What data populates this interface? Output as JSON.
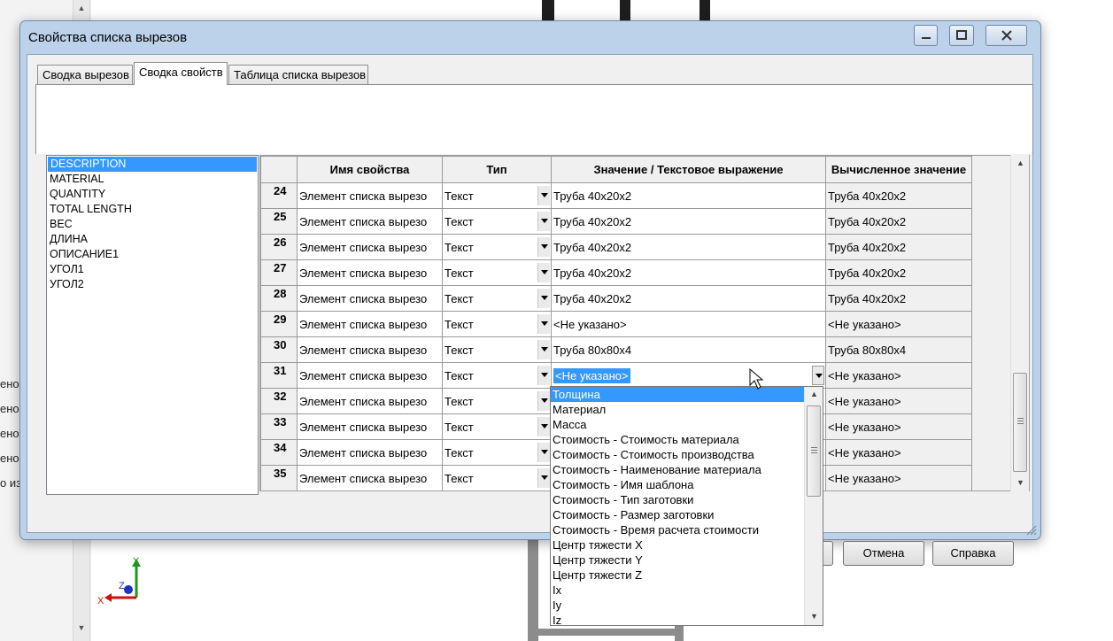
{
  "background": {
    "partial_lines": [
      "ено",
      "ено",
      "ено",
      "ено",
      "о из"
    ],
    "triad_labels": {
      "y": "Y",
      "z": "Z",
      "x": "X"
    }
  },
  "dialog": {
    "title": "Свойства списка вырезов",
    "tabs": [
      {
        "label": "Сводка вырезов"
      },
      {
        "label": "Сводка свойств"
      },
      {
        "label": "Таблица списка вырезов"
      }
    ],
    "active_tab": 1,
    "property_list": [
      "DESCRIPTION",
      "MATERIAL",
      "QUANTITY",
      "TOTAL LENGTH",
      "ВЕС",
      "ДЛИНА",
      "ОПИСАНИЕ1",
      "УГОЛ1",
      "УГОЛ2"
    ],
    "selected_property": 0,
    "grid": {
      "headers": [
        "",
        "Имя свойства",
        "Тип",
        "Значение / Текстовое выражение",
        "Вычисленное значение"
      ],
      "rows": [
        {
          "num": "24",
          "name": "Элемент списка вырезо",
          "type": "Текст",
          "value": "Труба 40x20x2",
          "computed": "Труба 40x20x2"
        },
        {
          "num": "25",
          "name": "Элемент списка вырезо",
          "type": "Текст",
          "value": "Труба 40x20x2",
          "computed": "Труба 40x20x2"
        },
        {
          "num": "26",
          "name": "Элемент списка вырезо",
          "type": "Текст",
          "value": "Труба 40x20x2",
          "computed": "Труба 40x20x2"
        },
        {
          "num": "27",
          "name": "Элемент списка вырезо",
          "type": "Текст",
          "value": "Труба 40x20x2",
          "computed": "Труба 40x20x2"
        },
        {
          "num": "28",
          "name": "Элемент списка вырезо",
          "type": "Текст",
          "value": "Труба 40x20x2",
          "computed": "Труба 40x20x2"
        },
        {
          "num": "29",
          "name": "Элемент списка вырезо",
          "type": "Текст",
          "value": "<Не указано>",
          "computed": "<Не указано>"
        },
        {
          "num": "30",
          "name": "Элемент списка вырезо",
          "type": "Текст",
          "value": "Труба 80x80x4",
          "computed": "Труба 80x80x4"
        },
        {
          "num": "31",
          "name": "Элемент списка вырезо",
          "type": "Текст",
          "value": "<Не указано>",
          "computed": "<Не указано>",
          "editing": true
        },
        {
          "num": "32",
          "name": "Элемент списка вырезо",
          "type": "Текст",
          "value": "",
          "computed": "<Не указано>"
        },
        {
          "num": "33",
          "name": "Элемент списка вырезо",
          "type": "Текст",
          "value": "",
          "computed": "<Не указано>"
        },
        {
          "num": "34",
          "name": "Элемент списка вырезо",
          "type": "Текст",
          "value": "",
          "computed": "<Не указано>"
        },
        {
          "num": "35",
          "name": "Элемент списка вырезо",
          "type": "Текст",
          "value": "",
          "computed": "<Не указано>"
        }
      ]
    },
    "dropdown_options": [
      "Толщина",
      "Материал",
      "Масса",
      "Стоимость - Стоимость материала",
      "Стоимость - Стоимость производства",
      "Стоимость - Наименование материала",
      "Стоимость - Имя шаблона",
      "Стоимость - Тип заготовки",
      "Стоимость - Размер заготовки",
      "Стоимость - Время расчета стоимости",
      "Центр тяжести X",
      "Центр тяжести Y",
      "Центр тяжести Z",
      "Ix",
      "Iy",
      "Iz"
    ],
    "dropdown_selected": 0,
    "buttons": {
      "cancel": "Отмена",
      "help": "Справка"
    }
  }
}
